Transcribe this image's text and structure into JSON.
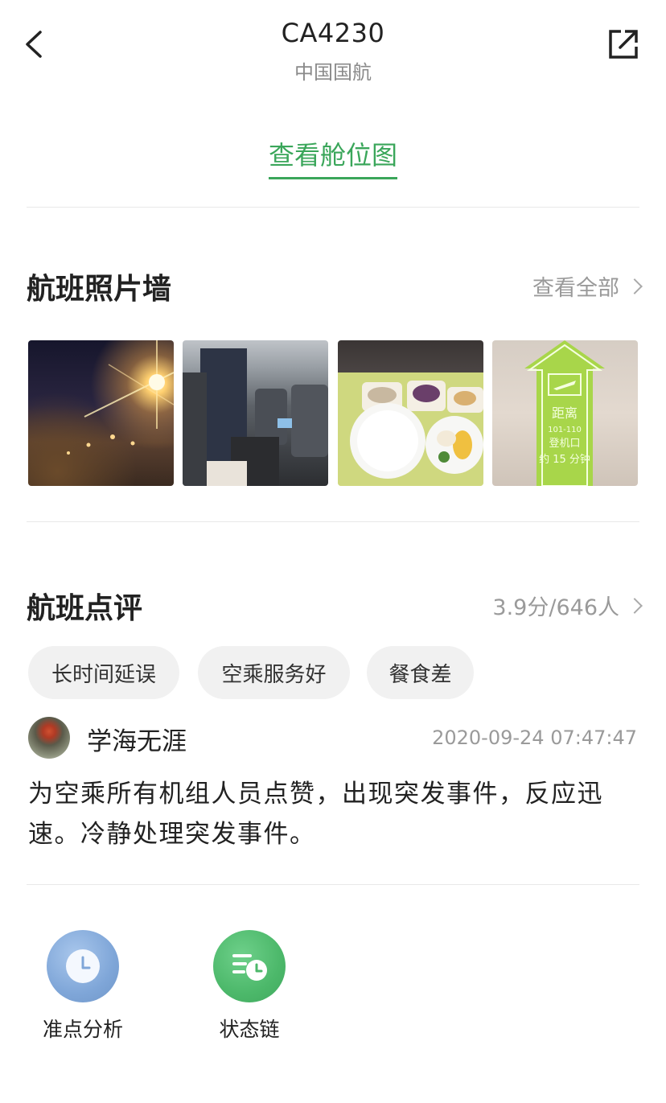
{
  "header": {
    "title": "CA4230",
    "subtitle": "中国国航",
    "back_icon": "chevron-left-icon",
    "share_icon": "share-external-icon"
  },
  "seat_map": {
    "label": "查看舱位图",
    "color": "#3aa65a"
  },
  "photo_wall": {
    "title": "航班照片墙",
    "more_label": "查看全部",
    "photos": [
      {
        "desc_icon": "night-runway-photo"
      },
      {
        "desc_icon": "cabin-interior-photo"
      },
      {
        "desc_icon": "inflight-meal-photo"
      },
      {
        "desc_icon": "boarding-gate-sign-photo",
        "sign_text": [
          "距离",
          "101-110",
          "登机口",
          "约 15 分钟"
        ]
      }
    ]
  },
  "reviews": {
    "title": "航班点评",
    "summary": "3.9分/646人",
    "tags": [
      "长时间延误",
      "空乘服务好",
      "餐食差"
    ],
    "items": [
      {
        "user": "学海无涯",
        "time": "2020-09-24 07:47:47",
        "text": "为空乘所有机组人员点赞，出现突发事件，反应迅速。冷静处理突发事件。"
      }
    ]
  },
  "actions": [
    {
      "label": "准点分析",
      "icon": "clock-icon",
      "color": "#7fa6d8"
    },
    {
      "label": "状态链",
      "icon": "status-list-clock-icon",
      "color": "#4cb86a"
    }
  ]
}
